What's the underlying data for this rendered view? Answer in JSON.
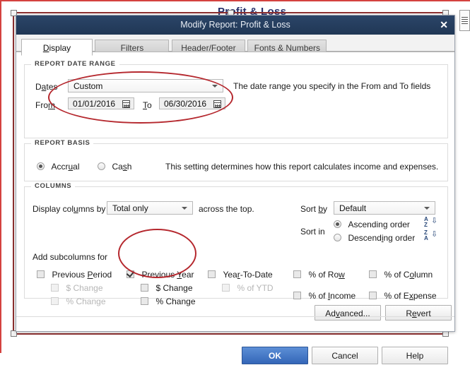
{
  "background": {
    "behind_title": "Profit & Loss",
    "edge_widget_icon": "list-lines-icon"
  },
  "dialog": {
    "title": "Modify Report: Profit & Loss",
    "close_label": "✕",
    "tabs": [
      {
        "label": "Display",
        "accel": "D",
        "active": true
      },
      {
        "label": "Filters",
        "accel": "F",
        "active": false
      },
      {
        "label": "Header/Footer",
        "accel": "H",
        "active": false
      },
      {
        "label": "Fonts & Numbers",
        "accel": "n",
        "active": false
      }
    ]
  },
  "report_date_range": {
    "group_title": "REPORT DATE RANGE",
    "dates_label": "Dates",
    "dates_accel": "a",
    "dates_value": "Custom",
    "from_label": "From",
    "from_accel": "m",
    "from_value": "01/01/2016",
    "to_label": "To",
    "to_accel": "T",
    "to_value": "06/30/2016",
    "hint": "The date range you specify in the From and To fields"
  },
  "report_basis": {
    "group_title": "REPORT BASIS",
    "accrual_label": "Accrual",
    "accrual_accel": "u",
    "accrual_selected": true,
    "cash_label": "Cash",
    "cash_accel": "s",
    "cash_selected": false,
    "hint": "This setting determines how this report calculates income and expenses."
  },
  "columns": {
    "group_title": "COLUMNS",
    "display_columns_by_label": "Display columns by",
    "display_columns_by_accel": "u",
    "display_columns_by_value": "Total only",
    "across_the_top_label": "across the top.",
    "sort_by_label": "Sort by",
    "sort_by_accel": "b",
    "sort_by_value": "Default",
    "sort_in_label": "Sort in",
    "ascending_label": "Ascending order",
    "ascending_accel": "g",
    "ascending_selected": true,
    "descending_label": "Descending order",
    "descending_accel": "i",
    "descending_selected": false,
    "ascending_icon": "sort-az-down-icon",
    "descending_icon": "sort-za-down-icon",
    "add_subcolumns_label": "Add subcolumns for",
    "checkboxes": [
      {
        "label": "Previous Period",
        "accel": "P",
        "checked": false,
        "disabled": false
      },
      {
        "label": "$ Change",
        "accel": "",
        "checked": false,
        "disabled": true
      },
      {
        "label": "% Change",
        "accel": "",
        "checked": false,
        "disabled": true
      },
      {
        "label": "Previous Year",
        "accel": "Y",
        "checked": true,
        "disabled": false
      },
      {
        "label": "$ Change",
        "accel": "",
        "checked": false,
        "disabled": false
      },
      {
        "label": "% Change",
        "accel": "",
        "checked": false,
        "disabled": false
      },
      {
        "label": "Year-To-Date",
        "accel": "r",
        "checked": false,
        "disabled": false
      },
      {
        "label": "% of YTD",
        "accel": "",
        "checked": false,
        "disabled": true
      },
      {
        "label": "% of Row",
        "accel": "w",
        "checked": false,
        "disabled": false
      },
      {
        "label": "% of Income",
        "accel": "I",
        "checked": false,
        "disabled": false
      },
      {
        "label": "% of Column",
        "accel": "o",
        "checked": false,
        "disabled": false
      },
      {
        "label": "% of Expense",
        "accel": "x",
        "checked": false,
        "disabled": false
      }
    ]
  },
  "buttons": {
    "advanced": "Advanced...",
    "advanced_accel": "v",
    "revert": "Revert",
    "revert_accel": "e",
    "ok": "OK",
    "cancel": "Cancel",
    "help": "Help"
  },
  "annotations": {
    "accent_color": "#b5282e",
    "ellipse_date_range": "highlight-date-range",
    "ellipse_previous_year": "highlight-previous-year"
  }
}
